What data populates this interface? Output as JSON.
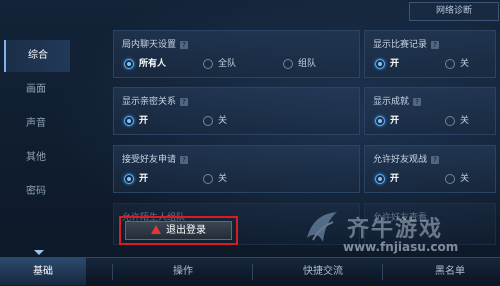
{
  "top": {
    "net_diag_label": "网络诊断"
  },
  "sidebar": {
    "items": [
      {
        "label": "综合",
        "active": true
      },
      {
        "label": "画面",
        "active": false
      },
      {
        "label": "声音",
        "active": false
      },
      {
        "label": "其他",
        "active": false
      },
      {
        "label": "密码",
        "active": false
      }
    ]
  },
  "settings": {
    "chat": {
      "title": "局内聊天设置",
      "options": [
        "所有人",
        "全队",
        "组队"
      ],
      "selected": "所有人"
    },
    "score": {
      "title": "显示比赛记录",
      "options": [
        "开",
        "关"
      ],
      "selected": "开"
    },
    "intimacy": {
      "title": "显示亲密关系",
      "options": [
        "开",
        "关"
      ],
      "selected": "开"
    },
    "achievement": {
      "title": "显示成就",
      "options": [
        "开",
        "关"
      ],
      "selected": "开"
    },
    "friend_req": {
      "title": "接受好友申请",
      "options": [
        "开",
        "关"
      ],
      "selected": "开"
    },
    "watch": {
      "title": "允许好友观战",
      "options": [
        "开",
        "关"
      ],
      "selected": "开"
    },
    "faded_left": {
      "title": "允许陌生人组队"
    },
    "faded_right": {
      "title": "允许好友查看"
    }
  },
  "logout": {
    "label": "退出登录"
  },
  "tabs": [
    {
      "label": "基础",
      "active": true
    },
    {
      "label": "操作",
      "active": false
    },
    {
      "label": "快捷交流",
      "active": false
    },
    {
      "label": "黑名单",
      "active": false
    }
  ],
  "watermark": {
    "title": "齐牛游戏",
    "url": "www.fnjiasu.com"
  },
  "colors": {
    "accent": "#5fb4ff",
    "logout_border": "#d51e22",
    "background": "#0e1a2c"
  }
}
